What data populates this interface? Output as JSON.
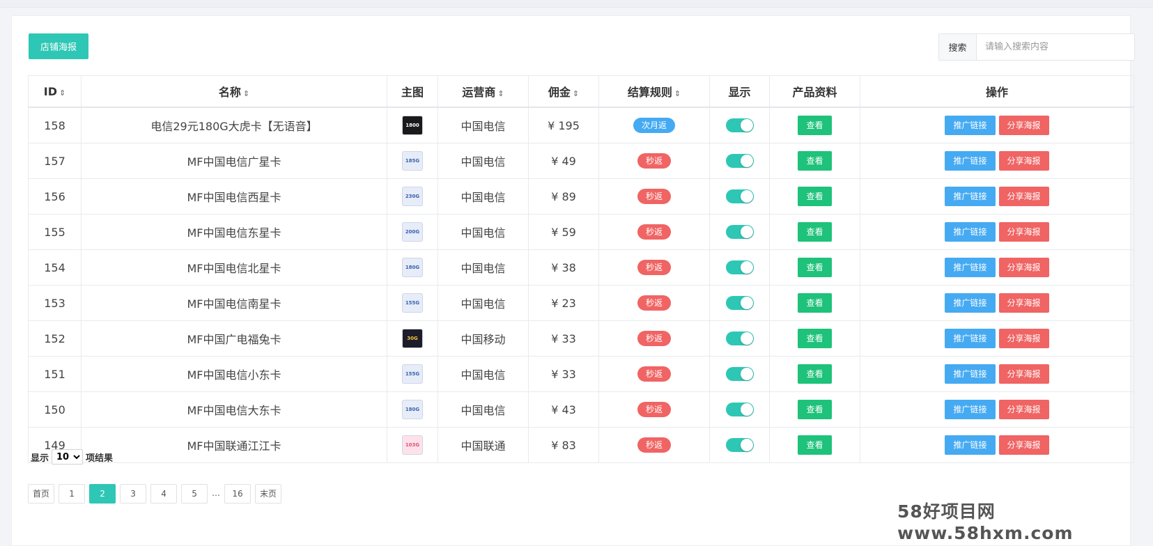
{
  "toolbar": {
    "poster_button": "店铺海报"
  },
  "search": {
    "label": "搜索",
    "placeholder": "请输入搜索内容"
  },
  "table": {
    "headers": {
      "id": "ID",
      "name": "名称",
      "image": "主图",
      "carrier": "运营商",
      "commission": "佣金",
      "rule": "结算规则",
      "display": "显示",
      "info": "产品资料",
      "ops": "操作"
    },
    "view_label": "查看",
    "promo_label": "推广链接",
    "share_label": "分享海报",
    "rows": [
      {
        "id": "158",
        "name": "电信29元180G大虎卡【无语音】",
        "thumb": "1800",
        "carrier": "中国电信",
        "commission": "¥ 195",
        "rule": "次月返",
        "rule_type": "monthly"
      },
      {
        "id": "157",
        "name": "MF中国电信广星卡",
        "thumb": "185G",
        "carrier": "中国电信",
        "commission": "¥ 49",
        "rule": "秒返",
        "rule_type": "instant"
      },
      {
        "id": "156",
        "name": "MF中国电信西星卡",
        "thumb": "230G",
        "carrier": "中国电信",
        "commission": "¥ 89",
        "rule": "秒返",
        "rule_type": "instant"
      },
      {
        "id": "155",
        "name": "MF中国电信东星卡",
        "thumb": "200G",
        "carrier": "中国电信",
        "commission": "¥ 59",
        "rule": "秒返",
        "rule_type": "instant"
      },
      {
        "id": "154",
        "name": "MF中国电信北星卡",
        "thumb": "180G",
        "carrier": "中国电信",
        "commission": "¥ 38",
        "rule": "秒返",
        "rule_type": "instant"
      },
      {
        "id": "153",
        "name": "MF中国电信南星卡",
        "thumb": "155G",
        "carrier": "中国电信",
        "commission": "¥ 23",
        "rule": "秒返",
        "rule_type": "instant"
      },
      {
        "id": "152",
        "name": "MF中国广电福兔卡",
        "thumb": "30G",
        "carrier": "中国移动",
        "commission": "¥ 33",
        "rule": "秒返",
        "rule_type": "instant"
      },
      {
        "id": "151",
        "name": "MF中国电信小东卡",
        "thumb": "155G",
        "carrier": "中国电信",
        "commission": "¥ 33",
        "rule": "秒返",
        "rule_type": "instant"
      },
      {
        "id": "150",
        "name": "MF中国电信大东卡",
        "thumb": "180G",
        "carrier": "中国电信",
        "commission": "¥ 43",
        "rule": "秒返",
        "rule_type": "instant"
      },
      {
        "id": "149",
        "name": "MF中国联通江江卡",
        "thumb": "103G",
        "carrier": "中国联通",
        "commission": "¥ 83",
        "rule": "秒返",
        "rule_type": "instant"
      }
    ]
  },
  "page_size": {
    "prefix": "显示",
    "value": "10",
    "suffix": "项结果"
  },
  "pagination": [
    "首页",
    "1",
    "2",
    "3",
    "4",
    "5",
    "…",
    "16",
    "末页"
  ],
  "pagination_active": "2",
  "watermark": "58好项目网www.58hxm.com",
  "colors": {
    "accent": "#2ec7b5",
    "view": "#1ec27a",
    "promo": "#45aaf2",
    "share": "#f06464",
    "pill_monthly": "#45aaf2",
    "pill_instant": "#f06464",
    "toggle_on": "#2ec7b5"
  },
  "icons": {
    "sort": "sort-updown-icon"
  }
}
